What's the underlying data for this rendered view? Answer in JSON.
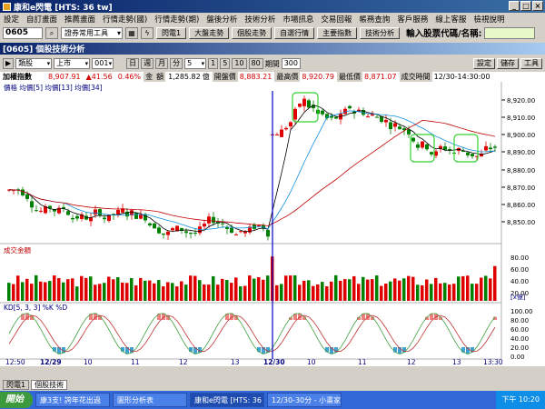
{
  "window": {
    "title": "康和e閃電 [HTS: 36 tw]",
    "buttons": [
      "_",
      "□",
      "×"
    ]
  },
  "menu": [
    "設定",
    "自訂畫面",
    "推薦畫面",
    "行情走勢(國)",
    "行情走勢(期)",
    "盤後分析",
    "技術分析",
    "市場訊息",
    "交易回報",
    "帳務查詢",
    "客戶服務",
    "線上客服",
    "檢視說明"
  ],
  "toolbar": {
    "code": "0605",
    "dropdown": "證券常用工具",
    "buttons": [
      "閃電1",
      "大盤走勢",
      "個股走勢",
      "自選行情",
      "主要指數",
      "技術分析"
    ],
    "stock_label": "輸入股票代碼/名稱:"
  },
  "inner": {
    "title": "[0605] 個股技術分析"
  },
  "controls": {
    "market": "類股",
    "exchange": "上市",
    "item": "001",
    "periods": [
      "日",
      "週",
      "月",
      "分"
    ],
    "minutes": "5",
    "ranges": [
      "1",
      "5",
      "10",
      "80"
    ],
    "period_label": "期間",
    "period_value": "300",
    "right_buttons": [
      "設定",
      "儲存",
      "工具"
    ]
  },
  "info": {
    "name": "加權指數",
    "price": "8,907.91",
    "change": "▲41.56",
    "pct": "0.46%",
    "vol_label": "金",
    "amt_label": "額",
    "amount": "1,285.82",
    "unit": "億",
    "open_label": "開盤價",
    "open": "8,883.21",
    "high_label": "最高價",
    "high": "8,920.79",
    "low_label": "最低價",
    "low": "8,871.07",
    "time_label": "成交時間",
    "time": "12/30-14:30:00"
  },
  "price_panel": {
    "legend": "價格 均價[5] 均價[13] 均價[34]",
    "yticks": [
      "8,920.00",
      "8,910.00",
      "8,900.00",
      "8,890.00",
      "8,880.00",
      "8,870.00",
      "8,860.00",
      "8,850.00"
    ]
  },
  "volume_panel": {
    "legend": "成交金額",
    "yticks": [
      "80.00",
      "60.00",
      "40.00",
      "20.00"
    ],
    "unit": "[x億]"
  },
  "kd_panel": {
    "legend": "KD[5, 3, 3] %K %D",
    "yticks": [
      "100.00",
      "80.00",
      "60.00",
      "40.00",
      "20.00",
      "0.00"
    ]
  },
  "xaxis": [
    "12:50",
    "12/29",
    "10",
    "11",
    "12",
    "13",
    "12/30",
    "10",
    "11",
    "12",
    "13",
    "13:30"
  ],
  "scroll": {
    "value": "120"
  },
  "tabs": [
    "閃電1",
    "個股技術"
  ],
  "taskbar": {
    "start": "開始",
    "tasks": [
      "康3支! 誇年花出過",
      "圖形分析表",
      "康和e閃電 [HTS: 36 ...",
      "12/30-30分 - 小畫家"
    ],
    "clock": "下午 10:20"
  },
  "colors": {
    "up": "#e00000",
    "down": "#008000",
    "ma5": "#000000",
    "ma13": "#1090e0",
    "ma34": "#c00000",
    "kline": "#40a040",
    "dline": "#c03030"
  }
}
